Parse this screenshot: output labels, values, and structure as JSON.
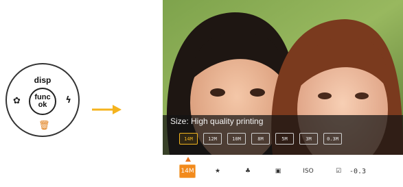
{
  "dial": {
    "top_label": "disp",
    "center_line1": "func",
    "center_line2": "ok",
    "left_icon": "macro-flower-icon",
    "right_icon": "flash-bolt-icon",
    "bottom_icon": "trash-icon"
  },
  "arrow": {
    "color": "#f4b31e"
  },
  "screen": {
    "size_caption": "Size: High quality printing",
    "size_options": [
      {
        "label": "14M",
        "selected": true
      },
      {
        "label": "12M",
        "selected": false
      },
      {
        "label": "10M",
        "selected": false
      },
      {
        "label": "8M",
        "selected": false
      },
      {
        "label": "5M",
        "selected": false
      },
      {
        "label": "3M",
        "selected": false
      },
      {
        "label": "0.3M",
        "selected": false
      }
    ],
    "menu_items": [
      {
        "label": "14M",
        "icon": "image-size-icon",
        "selected": true
      },
      {
        "label": "★",
        "icon": "quality-icon",
        "selected": false
      },
      {
        "label": "♣",
        "icon": "focus-mode-icon",
        "selected": false
      },
      {
        "label": "▣",
        "icon": "metering-icon",
        "selected": false
      },
      {
        "label": "ISO",
        "icon": "iso-icon",
        "selected": false
      },
      {
        "label": "☑",
        "icon": "exposure-icon",
        "selected": false
      }
    ],
    "ev_value": "-0.3"
  },
  "colors": {
    "accent": "#f28a1c",
    "selection": "#f2b51f"
  }
}
